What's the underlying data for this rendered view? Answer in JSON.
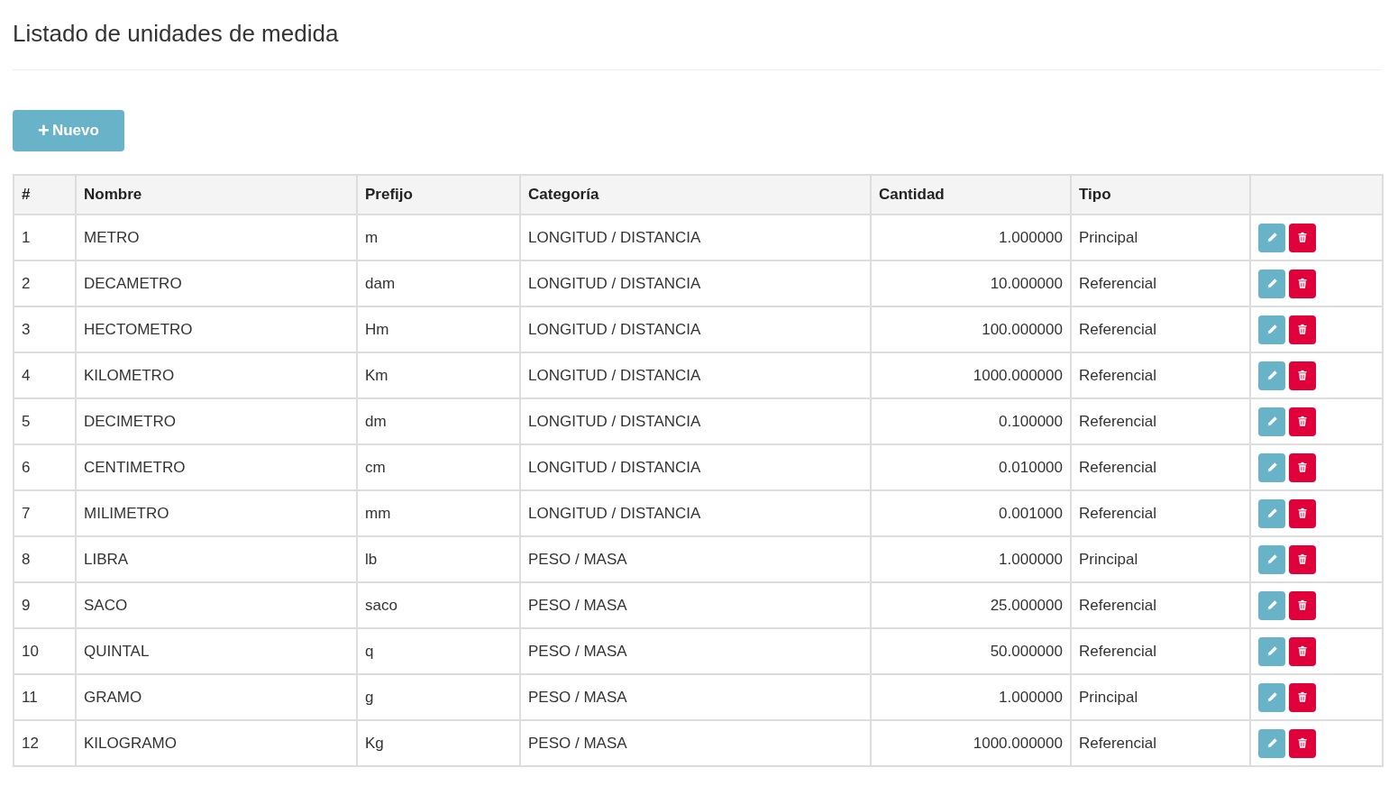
{
  "page": {
    "title": "Listado de unidades de medida"
  },
  "new_button": {
    "icon": "+",
    "label": "Nuevo"
  },
  "table": {
    "columns": [
      "#",
      "Nombre",
      "Prefijo",
      "Categoría",
      "Cantidad",
      "Tipo",
      ""
    ],
    "rows": [
      {
        "num": "1",
        "name": "METRO",
        "prefix": "m",
        "category": "LONGITUD / DISTANCIA",
        "quantity": "1.000000",
        "type": "Principal"
      },
      {
        "num": "2",
        "name": "DECAMETRO",
        "prefix": "dam",
        "category": "LONGITUD / DISTANCIA",
        "quantity": "10.000000",
        "type": "Referencial"
      },
      {
        "num": "3",
        "name": "HECTOMETRO",
        "prefix": "Hm",
        "category": "LONGITUD / DISTANCIA",
        "quantity": "100.000000",
        "type": "Referencial"
      },
      {
        "num": "4",
        "name": "KILOMETRO",
        "prefix": "Km",
        "category": "LONGITUD / DISTANCIA",
        "quantity": "1000.000000",
        "type": "Referencial"
      },
      {
        "num": "5",
        "name": "DECIMETRO",
        "prefix": "dm",
        "category": "LONGITUD / DISTANCIA",
        "quantity": "0.100000",
        "type": "Referencial"
      },
      {
        "num": "6",
        "name": "CENTIMETRO",
        "prefix": "cm",
        "category": "LONGITUD / DISTANCIA",
        "quantity": "0.010000",
        "type": "Referencial"
      },
      {
        "num": "7",
        "name": "MILIMETRO",
        "prefix": "mm",
        "category": "LONGITUD / DISTANCIA",
        "quantity": "0.001000",
        "type": "Referencial"
      },
      {
        "num": "8",
        "name": "LIBRA",
        "prefix": "lb",
        "category": "PESO / MASA",
        "quantity": "1.000000",
        "type": "Principal"
      },
      {
        "num": "9",
        "name": "SACO",
        "prefix": "saco",
        "category": "PESO / MASA",
        "quantity": "25.000000",
        "type": "Referencial"
      },
      {
        "num": "10",
        "name": "QUINTAL",
        "prefix": "q",
        "category": "PESO / MASA",
        "quantity": "50.000000",
        "type": "Referencial"
      },
      {
        "num": "11",
        "name": "GRAMO",
        "prefix": "g",
        "category": "PESO / MASA",
        "quantity": "1.000000",
        "type": "Principal"
      },
      {
        "num": "12",
        "name": "KILOGRAMO",
        "prefix": "Kg",
        "category": "PESO / MASA",
        "quantity": "1000.000000",
        "type": "Referencial"
      }
    ]
  }
}
